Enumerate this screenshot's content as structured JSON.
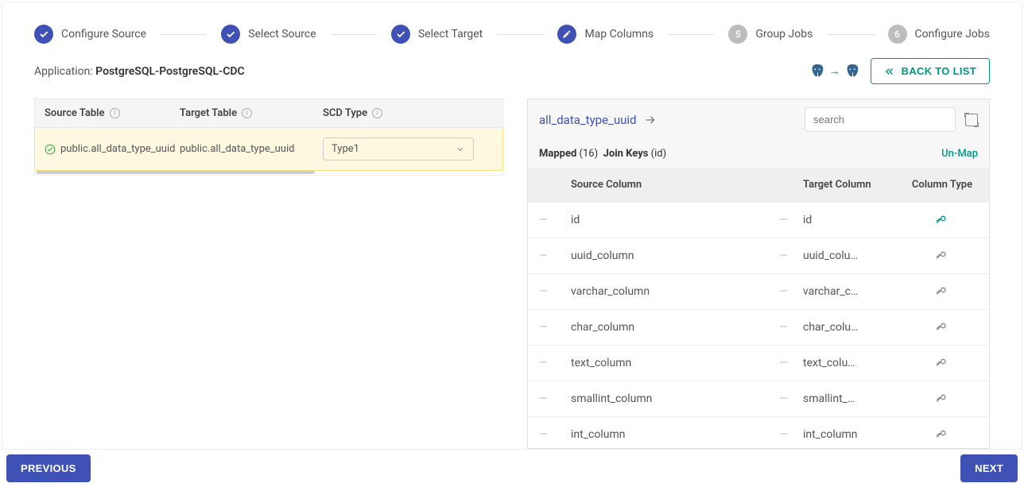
{
  "stepper": {
    "steps": [
      {
        "label": "Configure Source",
        "state": "done"
      },
      {
        "label": "Select Source",
        "state": "done"
      },
      {
        "label": "Select Target",
        "state": "done"
      },
      {
        "label": "Map Columns",
        "state": "active"
      },
      {
        "label": "Group Jobs",
        "state": "pending",
        "num": "5"
      },
      {
        "label": "Configure Jobs",
        "state": "pending",
        "num": "6"
      }
    ]
  },
  "application": {
    "prefix": "Application: ",
    "name": "PostgreSQL-PostgreSQL-CDC"
  },
  "back_button": "BACK TO LIST",
  "left_table": {
    "headers": {
      "source": "Source Table",
      "target": "Target Table",
      "scd": "SCD Type"
    },
    "rows": [
      {
        "source": "public.all_data_type_uuid",
        "target": "public.all_data_type_uuid",
        "scd": "Type1"
      }
    ]
  },
  "right_panel": {
    "title": "all_data_type_uuid",
    "search_placeholder": "search",
    "mapped_label": "Mapped",
    "mapped_count": "(16)",
    "join_label": "Join Keys",
    "join_value": "(id)",
    "unmap": "Un-Map",
    "cols": {
      "source": "Source Column",
      "target": "Target Column",
      "type": "Column Type"
    },
    "rows": [
      {
        "source": "id",
        "target": "id",
        "primary": true
      },
      {
        "source": "uuid_column",
        "target": "uuid_colu…",
        "primary": false
      },
      {
        "source": "varchar_column",
        "target": "varchar_c…",
        "primary": false
      },
      {
        "source": "char_column",
        "target": "char_colu…",
        "primary": false
      },
      {
        "source": "text_column",
        "target": "text_colu…",
        "primary": false
      },
      {
        "source": "smallint_column",
        "target": "smallint_…",
        "primary": false
      },
      {
        "source": "int_column",
        "target": "int_column",
        "primary": false
      }
    ]
  },
  "footer": {
    "prev": "PREVIOUS",
    "next": "NEXT"
  }
}
